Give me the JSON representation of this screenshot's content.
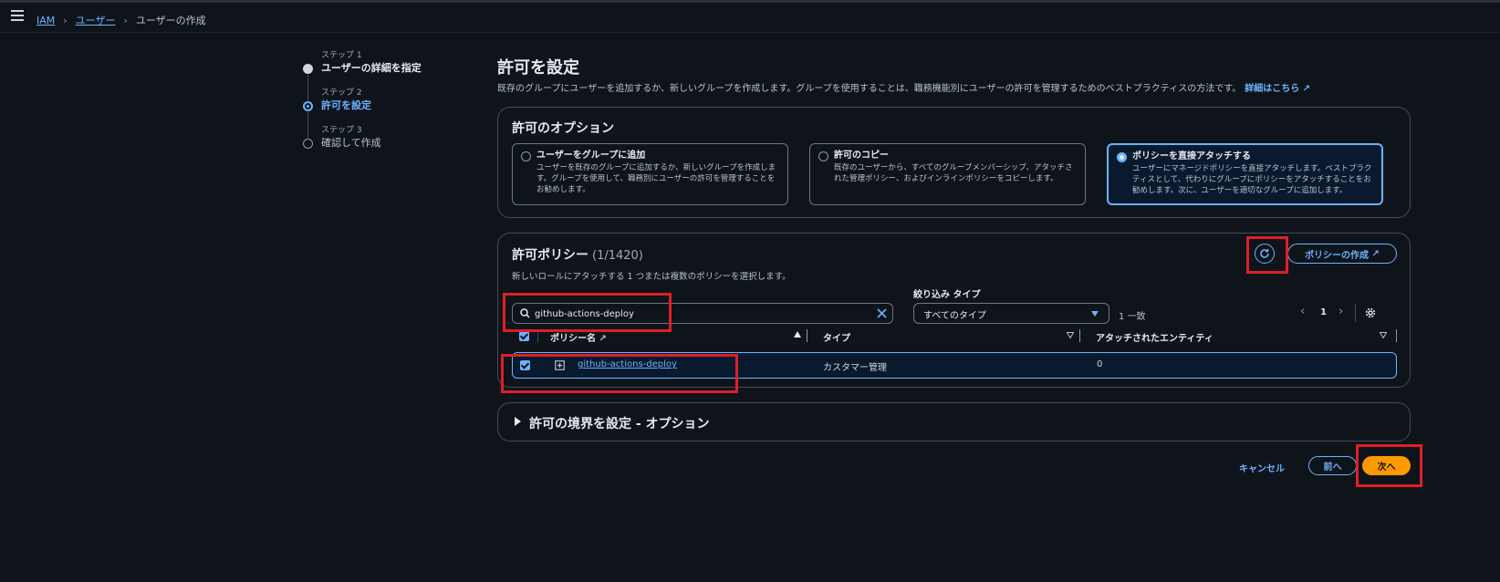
{
  "breadcrumb": {
    "iam": "IAM",
    "users": "ユーザー",
    "current": "ユーザーの作成"
  },
  "steps": [
    {
      "label": "ステップ 1",
      "title": "ユーザーの詳細を指定"
    },
    {
      "label": "ステップ 2",
      "title": "許可を設定"
    },
    {
      "label": "ステップ 3",
      "title": "確認して作成"
    }
  ],
  "page": {
    "title": "許可を設定",
    "description": "既存のグループにユーザーを追加するか、新しいグループを作成します。グループを使用することは、職務機能別にユーザーの許可を管理するためのベストプラクティスの方法です。",
    "learn_more": "詳細はこちら"
  },
  "options": {
    "title": "許可のオプション",
    "items": [
      {
        "title": "ユーザーをグループに追加",
        "desc": "ユーザーを既存のグループに追加するか、新しいグループを作成します。グループを使用して、職務別にユーザーの許可を管理することをお勧めします。"
      },
      {
        "title": "許可のコピー",
        "desc": "既存のユーザーから、すべてのグループメンバーシップ、アタッチされた管理ポリシー、およびインラインポリシーをコピーします。"
      },
      {
        "title": "ポリシーを直接アタッチする",
        "desc": "ユーザーにマネージドポリシーを直接アタッチします。ベストプラクティスとして、代わりにグループにポリシーをアタッチすることをお勧めします。次に、ユーザーを適切なグループに追加します。"
      }
    ],
    "selected_index": 2
  },
  "policies": {
    "title": "許可ポリシー",
    "count": "(1/1420)",
    "subtitle": "新しいロールにアタッチする 1 つまたは複数のポリシーを選択します。",
    "create_button": "ポリシーの作成",
    "search_value": "github-actions-deploy",
    "filter_label": "絞り込み タイプ",
    "filter_value": "すべてのタイプ",
    "match_count": "1 一致",
    "page_number": "1",
    "columns": {
      "name": "ポリシー名",
      "type": "タイプ",
      "attached": "アタッチされたエンティティ"
    },
    "rows": [
      {
        "name": "github-actions-deploy",
        "type": "カスタマー管理",
        "attached": "0"
      }
    ]
  },
  "boundary": {
    "title": "許可の境界を設定 - オプション"
  },
  "footer": {
    "cancel": "キャンセル",
    "previous": "前へ",
    "next": "次へ"
  },
  "colors": {
    "accent": "#6cb2ff",
    "primary": "#ff9900",
    "highlight": "#e01e26",
    "background": "#0f141b"
  }
}
